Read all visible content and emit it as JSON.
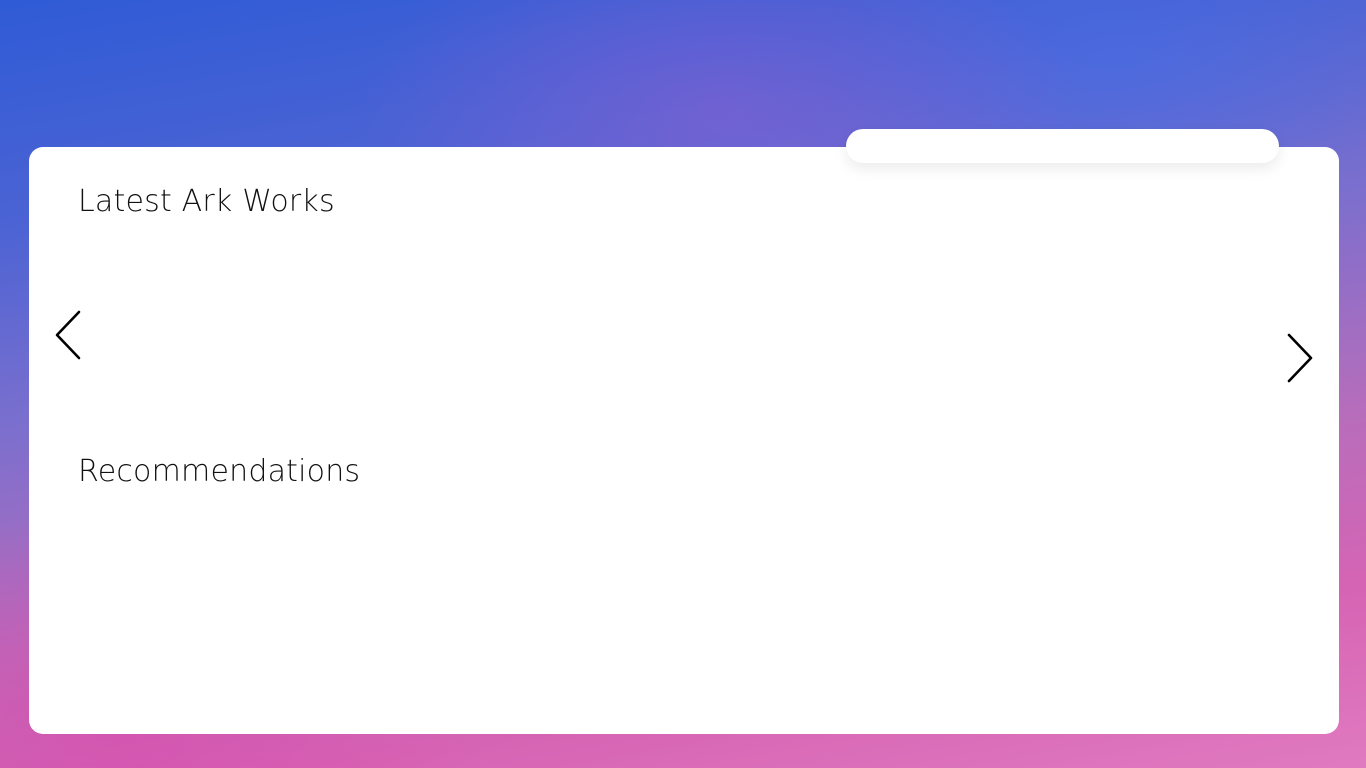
{
  "search": {
    "value": "",
    "placeholder": ""
  },
  "sections": {
    "latest_title": "Latest Ark Works",
    "recommendations_title": "Recommendations"
  },
  "icons": {
    "prev": "chevron-left-icon",
    "next": "chevron-right-icon"
  },
  "colors": {
    "card": "#ffffff",
    "text": "#111111",
    "bg_top": "#2f5bd6",
    "bg_bottom": "#e07ac0"
  }
}
